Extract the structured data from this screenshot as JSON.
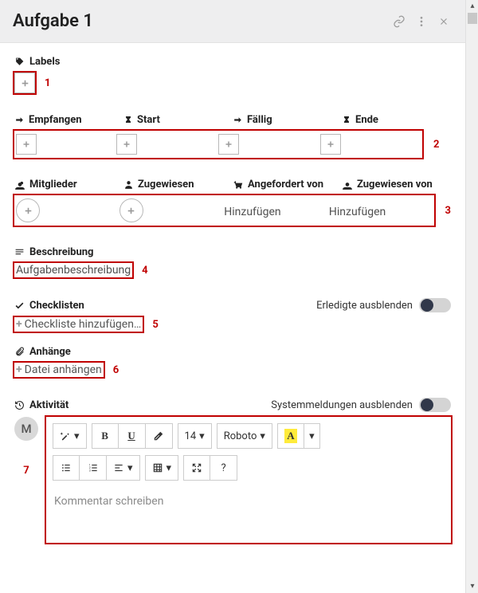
{
  "header": {
    "title": "Aufgabe 1"
  },
  "annotations": {
    "n1": "1",
    "n2": "2",
    "n3": "3",
    "n4": "4",
    "n5": "5",
    "n6": "6",
    "n7": "7"
  },
  "labels": {
    "title": "Labels"
  },
  "dates": {
    "received": "Empfangen",
    "start": "Start",
    "due": "Fällig",
    "end": "Ende"
  },
  "people": {
    "members": "Mitglieder",
    "assignees": "Zugewiesen",
    "requested_by": "Angefordert von",
    "assigned_by": "Zugewiesen von",
    "add_text": "Hinzufügen"
  },
  "description": {
    "title": "Beschreibung",
    "placeholder": "Aufgabenbeschreibung"
  },
  "checklists": {
    "title": "Checklisten",
    "hide_done": "Erledigte ausblenden",
    "add": "Checkliste hinzufügen…"
  },
  "attachments": {
    "title": "Anhänge",
    "add": "Datei anhängen"
  },
  "activity": {
    "title": "Aktivität",
    "hide_system": "Systemmeldungen ausblenden",
    "avatar_initial": "M",
    "comment_placeholder": "Kommentar schreiben"
  },
  "editor": {
    "font_size": "14",
    "font_family": "Roboto",
    "color_sample": "A"
  }
}
